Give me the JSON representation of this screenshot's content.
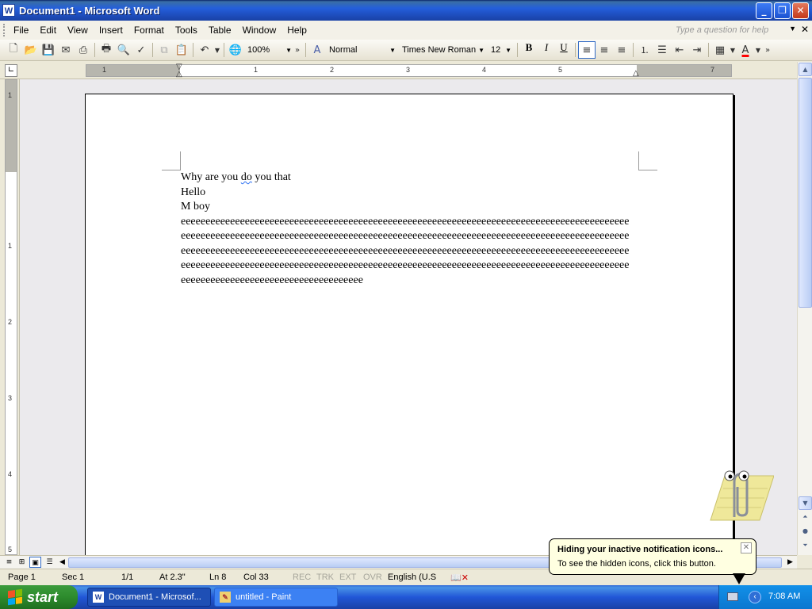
{
  "window": {
    "title": "Document1 - Microsoft Word",
    "app_icon": "W"
  },
  "menu": {
    "items": [
      "File",
      "Edit",
      "View",
      "Insert",
      "Format",
      "Tools",
      "Table",
      "Window",
      "Help"
    ],
    "help_placeholder": "Type a question for help"
  },
  "toolbar": {
    "zoom": "100%",
    "style": "Normal",
    "font": "Times New Roman",
    "size": "12",
    "bold": "B",
    "italic": "I",
    "underline": "U"
  },
  "ruler": {
    "numbers": [
      "1",
      "1",
      "2",
      "3",
      "4",
      "5",
      "7"
    ],
    "vertical_numbers": [
      "1",
      "1",
      "2",
      "3",
      "4",
      "5"
    ]
  },
  "document": {
    "lines": [
      "Why are you do you that",
      "Hello",
      "M boy",
      "eeeeeeeeeeeeeeeeeeeeeeeeeeeeeeeeeeeeeeeeeeeeeeeeeeeeeeeeeeeeeeeeeeeeeeeeeeeeeeeeeeeeeeeeeee",
      "eeeeeeeeeeeeeeeeeeeeeeeeeeeeeeeeeeeeeeeeeeeeeeeeeeeeeeeeeeeeeeeeeeeeeeeeeeeeeeeeeeeeeeeeeee",
      "eeeeeeeeeeeeeeeeeeeeeeeeeeeeeeeeeeeeeeeeeeeeeeeeeeeeeeeeeeeeeeeeeeeeeeeeeeeeeeeeeeeeeeeeeee",
      "eeeeeeeeeeeeeeeeeeeeeeeeeeeeeeeeeeeeeeeeeeeeeeeeeeeeeeeeeeeeeeeeeeeeeeeeeeeeeeeeeeeeeeeeeee",
      "eeeeeeeeeeeeeeeeeeeeeeeeeeeeeeeeeeeee"
    ]
  },
  "status": {
    "page": "Page  1",
    "sec": "Sec  1",
    "pages": "1/1",
    "at": "At  2.3\"",
    "ln": "Ln  8",
    "col": "Col  33",
    "rec": "REC",
    "trk": "TRK",
    "ext": "EXT",
    "ovr": "OVR",
    "language": "English (U.S"
  },
  "balloon": {
    "title": "Hiding your inactive notification icons...",
    "text": "To see the hidden icons, click this button."
  },
  "taskbar": {
    "start": "start",
    "tasks": [
      "Document1 - Microsof...",
      "untitled - Paint"
    ],
    "clock": "7:08 AM"
  },
  "colors": {
    "titlebar": "#245edb",
    "taskbar": "#245edb",
    "start": "#2d8b2d",
    "font_color_bar": "#ff0000"
  }
}
